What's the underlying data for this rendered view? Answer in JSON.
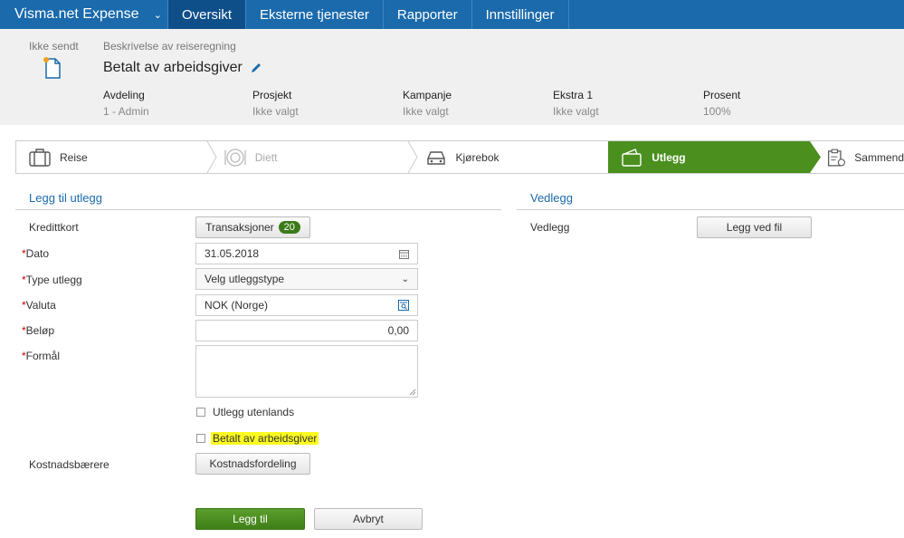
{
  "nav": {
    "brand": "Visma.net Expense",
    "tabs": [
      "Oversikt",
      "Eksterne tjenester",
      "Rapporter",
      "Innstillinger"
    ]
  },
  "header": {
    "status": "Ikke sendt",
    "desc_label": "Beskrivelse av reiseregning",
    "title": "Betalt av arbeidsgiver",
    "fields": [
      {
        "key": "Avdeling",
        "value": "1 - Admin"
      },
      {
        "key": "Prosjekt",
        "value": "Ikke valgt"
      },
      {
        "key": "Kampanje",
        "value": "Ikke valgt"
      },
      {
        "key": "Ekstra 1",
        "value": "Ikke valgt"
      },
      {
        "key": "Prosent",
        "value": "100%"
      }
    ]
  },
  "steps": [
    {
      "label": "Reise",
      "icon": "suitcase-icon"
    },
    {
      "label": "Diett",
      "icon": "plate-icon"
    },
    {
      "label": "Kjørebok",
      "icon": "car-icon"
    },
    {
      "label": "Utlegg",
      "icon": "wallet-icon"
    },
    {
      "label": "Sammend",
      "icon": "clipboard-icon"
    }
  ],
  "form": {
    "section_title": "Legg til utlegg",
    "kredittkort_label": "Kredittkort",
    "transaksjoner_label": "Transaksjoner",
    "transaksjoner_count": "20",
    "dato_label": "Dato",
    "dato_value": "31.05.2018",
    "type_label": "Type utlegg",
    "type_value": "Velg utleggstype",
    "valuta_label": "Valuta",
    "valuta_value": "NOK (Norge)",
    "belop_label": "Beløp",
    "belop_value": "0,00",
    "formal_label": "Formål",
    "utenlands_label": "Utlegg utenlands",
    "betalt_label": "Betalt av arbeidsgiver",
    "kostnad_label": "Kostnadsbærere",
    "kostnad_button": "Kostnadsfordeling",
    "save_button": "Legg til",
    "cancel_button": "Avbryt"
  },
  "vedlegg": {
    "section_title": "Vedlegg",
    "label": "Vedlegg",
    "button": "Legg ved fil"
  },
  "colors": {
    "nav_blue": "#1a6aac",
    "active_step_green": "#4b8f1f",
    "highlight_yellow": "#fbfb20"
  }
}
